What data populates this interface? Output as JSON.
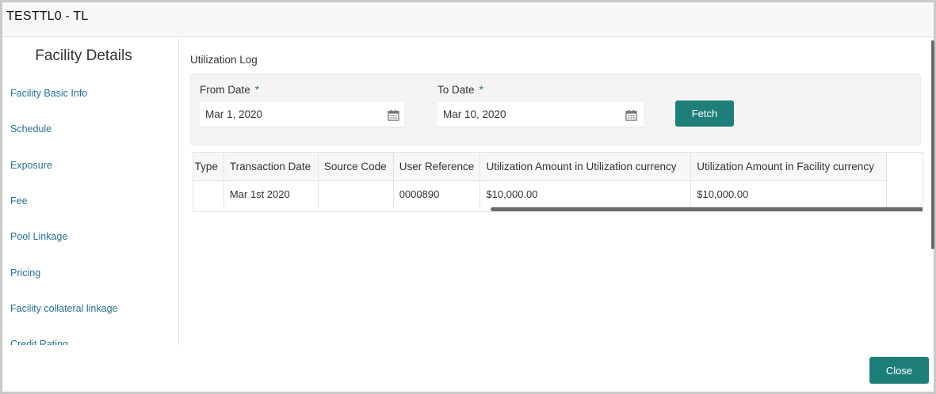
{
  "window": {
    "title": "TESTTL0 - TL"
  },
  "sidebar": {
    "heading": "Facility Details",
    "items": [
      {
        "label": "Facility Basic Info"
      },
      {
        "label": "Schedule"
      },
      {
        "label": "Exposure"
      },
      {
        "label": "Fee"
      },
      {
        "label": "Pool Linkage"
      },
      {
        "label": "Pricing"
      },
      {
        "label": "Facility collateral linkage"
      },
      {
        "label": "Credit Rating"
      }
    ]
  },
  "main": {
    "section_title": "Utilization Log",
    "filters": {
      "from_date_label": "From Date",
      "from_date_value": "Mar 1, 2020",
      "to_date_label": "To Date",
      "to_date_value": "Mar 10, 2020",
      "required_marker": "*",
      "fetch_label": "Fetch"
    },
    "table": {
      "columns": [
        "mit Type",
        "Transaction Date",
        "Source Code",
        "User Reference",
        "Utilization Amount in Utilization currency",
        "Utilization Amount in Facility currency"
      ],
      "rows": [
        [
          "",
          "Mar 1st 2020",
          "",
          "0000890",
          "$10,000.00",
          "$10,000.00"
        ]
      ]
    }
  },
  "footer": {
    "close_label": "Close"
  },
  "colors": {
    "accent": "#1e7f7a",
    "link": "#2a6f97",
    "required": "#2a6f97"
  },
  "icons": {
    "date_picker": "calendar-icon"
  }
}
